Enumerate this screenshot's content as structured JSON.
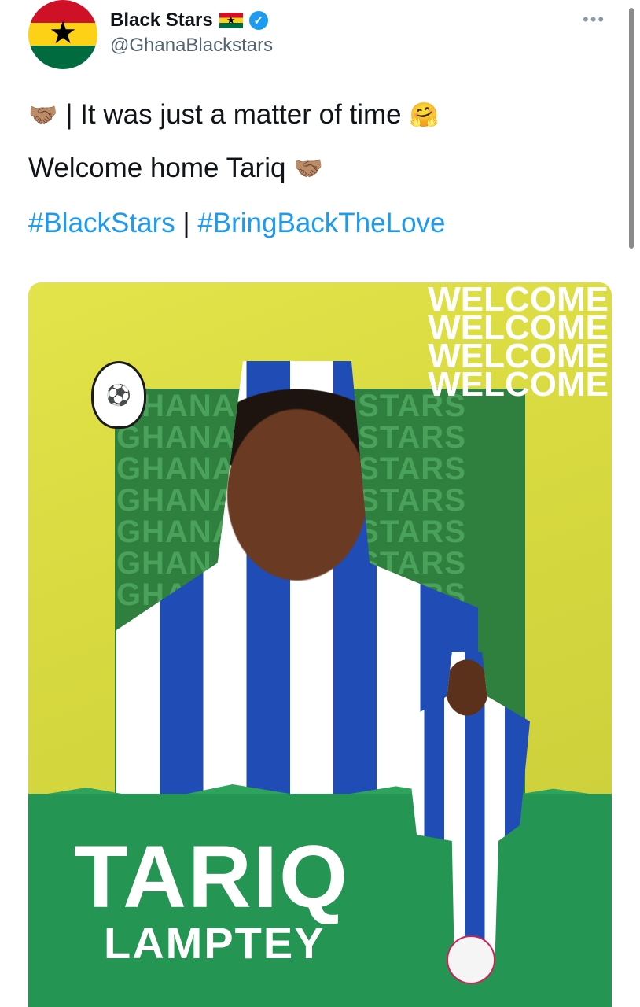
{
  "tweet": {
    "display_name": "Black Stars",
    "handle": "@GhanaBlackstars",
    "line1": "| It was just a matter of time",
    "line2": "Welcome home Tariq",
    "hashtag1": "#BlackStars",
    "separator": "|",
    "hashtag2": "#BringBackTheLove",
    "more_label": "•••",
    "verified_mark": "✓",
    "emoji_handshake": "🤝🏽",
    "emoji_hug": "🤗"
  },
  "graphic": {
    "welcome_words": [
      "WELCOME",
      "WELCOME",
      "WELCOME",
      "WELCOME"
    ],
    "bg_words": [
      "GHANA BLACKSTARS",
      "GHANA BLACKSTARS",
      "GHANA BLACKSTARS",
      "GHANA BLACKSTARS",
      "GHANA BLACKSTARS",
      "GHANA BLACKSTARS",
      "GHANA BLACKSTARS"
    ],
    "first_name": "TARIQ",
    "last_name": "LAMPTEY"
  },
  "colors": {
    "accent_blue": "#1d9bf0",
    "ghana_red": "#ce1126",
    "ghana_gold": "#fcd116",
    "ghana_green": "#006b3f"
  }
}
